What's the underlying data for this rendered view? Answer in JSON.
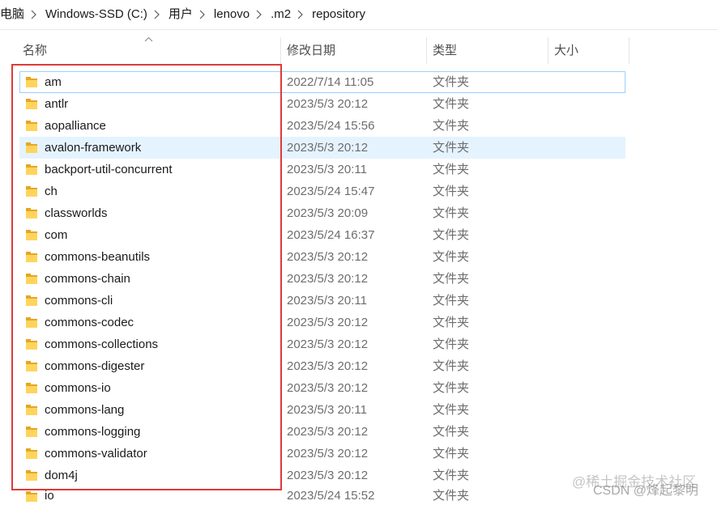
{
  "breadcrumb": {
    "items": [
      "电脑",
      "Windows-SSD (C:)",
      "用户",
      "lenovo",
      ".m2",
      "repository"
    ],
    "separator_icon": "chevron-right-icon"
  },
  "columns": {
    "name": "名称",
    "modified": "修改日期",
    "type": "类型",
    "size": "大小",
    "sort_column": "name",
    "sort_order": "ascending",
    "sort_icon": "chevron-up-icon"
  },
  "rows": [
    {
      "icon": "folder-icon",
      "name": "am",
      "modified": "2022/7/14 11:05",
      "type": "文件夹",
      "state": "focused"
    },
    {
      "icon": "folder-icon",
      "name": "antlr",
      "modified": "2023/5/3 20:12",
      "type": "文件夹"
    },
    {
      "icon": "folder-icon",
      "name": "aopalliance",
      "modified": "2023/5/24 15:56",
      "type": "文件夹"
    },
    {
      "icon": "folder-icon",
      "name": "avalon-framework",
      "modified": "2023/5/3 20:12",
      "type": "文件夹",
      "state": "hover"
    },
    {
      "icon": "folder-icon",
      "name": "backport-util-concurrent",
      "modified": "2023/5/3 20:11",
      "type": "文件夹"
    },
    {
      "icon": "folder-icon",
      "name": "ch",
      "modified": "2023/5/24 15:47",
      "type": "文件夹"
    },
    {
      "icon": "folder-icon",
      "name": "classworlds",
      "modified": "2023/5/3 20:09",
      "type": "文件夹"
    },
    {
      "icon": "folder-icon",
      "name": "com",
      "modified": "2023/5/24 16:37",
      "type": "文件夹"
    },
    {
      "icon": "folder-icon",
      "name": "commons-beanutils",
      "modified": "2023/5/3 20:12",
      "type": "文件夹"
    },
    {
      "icon": "folder-icon",
      "name": "commons-chain",
      "modified": "2023/5/3 20:12",
      "type": "文件夹"
    },
    {
      "icon": "folder-icon",
      "name": "commons-cli",
      "modified": "2023/5/3 20:11",
      "type": "文件夹"
    },
    {
      "icon": "folder-icon",
      "name": "commons-codec",
      "modified": "2023/5/3 20:12",
      "type": "文件夹"
    },
    {
      "icon": "folder-icon",
      "name": "commons-collections",
      "modified": "2023/5/3 20:12",
      "type": "文件夹"
    },
    {
      "icon": "folder-icon",
      "name": "commons-digester",
      "modified": "2023/5/3 20:12",
      "type": "文件夹"
    },
    {
      "icon": "folder-icon",
      "name": "commons-io",
      "modified": "2023/5/3 20:12",
      "type": "文件夹"
    },
    {
      "icon": "folder-icon",
      "name": "commons-lang",
      "modified": "2023/5/3 20:11",
      "type": "文件夹"
    },
    {
      "icon": "folder-icon",
      "name": "commons-logging",
      "modified": "2023/5/3 20:12",
      "type": "文件夹"
    },
    {
      "icon": "folder-icon",
      "name": "commons-validator",
      "modified": "2023/5/3 20:12",
      "type": "文件夹"
    },
    {
      "icon": "folder-icon",
      "name": "dom4j",
      "modified": "2023/5/3 20:12",
      "type": "文件夹"
    },
    {
      "icon": "folder-icon",
      "name": "io",
      "modified": "2023/5/24 15:52",
      "type": "文件夹"
    }
  ],
  "watermarks": [
    "@稀土掘金技术社区",
    "CSDN @烽起黎明"
  ],
  "colors": {
    "annotation_border": "#dd3a3a",
    "focus_border": "#99d1ff",
    "hover_background": "#e5f3ff",
    "secondary_text": "#6d6d6d",
    "folder_front": "#ffd45c",
    "folder_back": "#e6a622"
  }
}
